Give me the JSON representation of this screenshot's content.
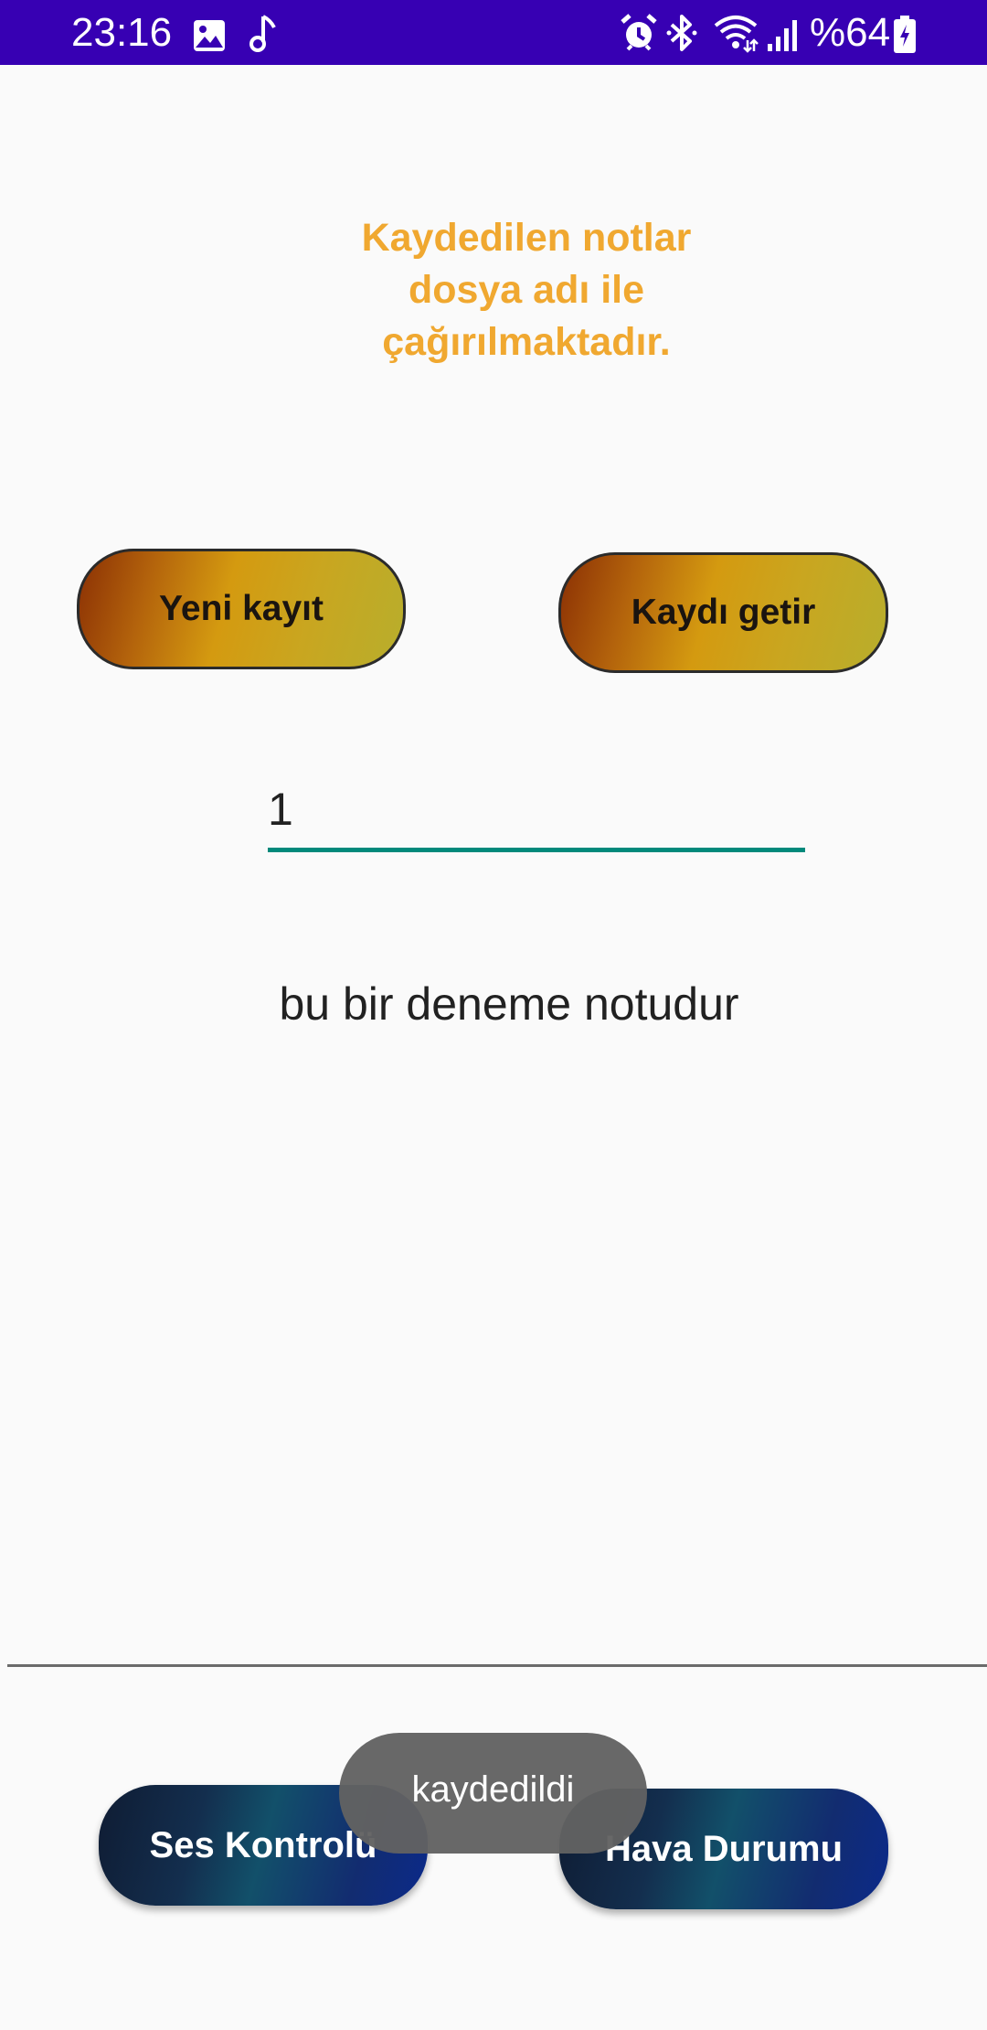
{
  "status_bar": {
    "time": "23:16",
    "battery_text": "%64",
    "icons_left": [
      "gallery-icon",
      "music-note-icon"
    ],
    "icons_right": [
      "alarm-icon",
      "bluetooth-icon",
      "wifi-icon",
      "signal-icon",
      "battery-icon"
    ],
    "background": "#3700B3"
  },
  "heading": {
    "line1": "Kaydedilen notlar",
    "line2": "dosya adı ile",
    "line3": "çağırılmaktadır.",
    "color": "#F0A830"
  },
  "buttons": {
    "new_record": "Yeni kayıt",
    "fetch_record": "Kaydı getir",
    "sound_control": "Ses Kontrolü",
    "weather": "Hava Durumu"
  },
  "file_input": {
    "value": "1",
    "underline_color": "#00897B"
  },
  "note": {
    "text": "bu bir deneme notudur"
  },
  "toast": {
    "text": "kaydedildi"
  }
}
